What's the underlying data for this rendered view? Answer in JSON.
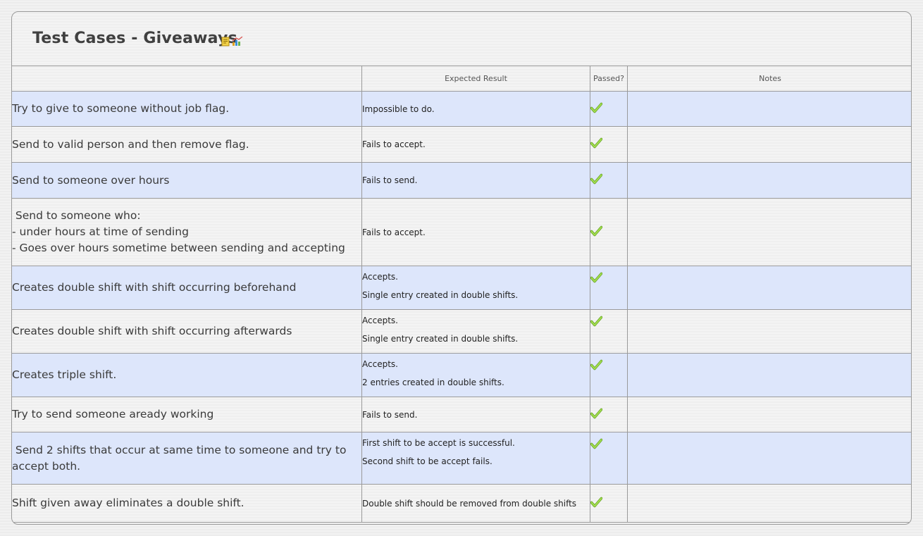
{
  "title": "Test Cases - Giveaways",
  "icons": [
    "note-icon",
    "chart-icon"
  ],
  "columns": {
    "case": "",
    "expected": "Expected Result",
    "passed": "Passed?",
    "notes": "Notes"
  },
  "rows": [
    {
      "case": [
        "Try to give to someone without job flag."
      ],
      "expected": [
        "Impossible to do."
      ],
      "passed": true,
      "notes": ""
    },
    {
      "case": [
        "Send to valid person and then remove flag."
      ],
      "expected": [
        "Fails to accept."
      ],
      "passed": true,
      "notes": ""
    },
    {
      "case": [
        "Send to someone over hours"
      ],
      "expected": [
        "Fails to send."
      ],
      "passed": true,
      "notes": ""
    },
    {
      "case": [
        " Send to someone who:",
        "- under hours at time of sending",
        "- Goes over hours sometime between sending and accepting"
      ],
      "expected": [
        "Fails to accept."
      ],
      "passed": true,
      "notes": ""
    },
    {
      "case": [
        "Creates double shift with shift occurring beforehand"
      ],
      "expected": [
        "Accepts.",
        "Single entry created in double shifts."
      ],
      "passed": true,
      "notes": ""
    },
    {
      "case": [
        "Creates double shift with shift occurring afterwards"
      ],
      "expected": [
        "Accepts.",
        "Single entry created in double shifts."
      ],
      "passed": true,
      "notes": ""
    },
    {
      "case": [
        "Creates triple shift."
      ],
      "expected": [
        "Accepts.",
        "2 entries created in double shifts."
      ],
      "passed": true,
      "notes": ""
    },
    {
      "case": [
        "Try to send someone aready working"
      ],
      "expected": [
        "Fails to send."
      ],
      "passed": true,
      "notes": ""
    },
    {
      "case": [
        " Send 2 shifts that occur at same time to someone and try to",
        "accept both."
      ],
      "expected": [
        "First shift to be accept is successful.",
        "Second shift to be accept fails."
      ],
      "passed": true,
      "notes": ""
    },
    {
      "case": [
        "Shift given away eliminates a double shift."
      ],
      "expected": [
        "Double shift should be removed from double shifts"
      ],
      "passed": true,
      "notes": ""
    }
  ],
  "colors": {
    "row_alt": "#dde6fb",
    "border": "#9a9a9a",
    "check": "#8cc63f"
  }
}
